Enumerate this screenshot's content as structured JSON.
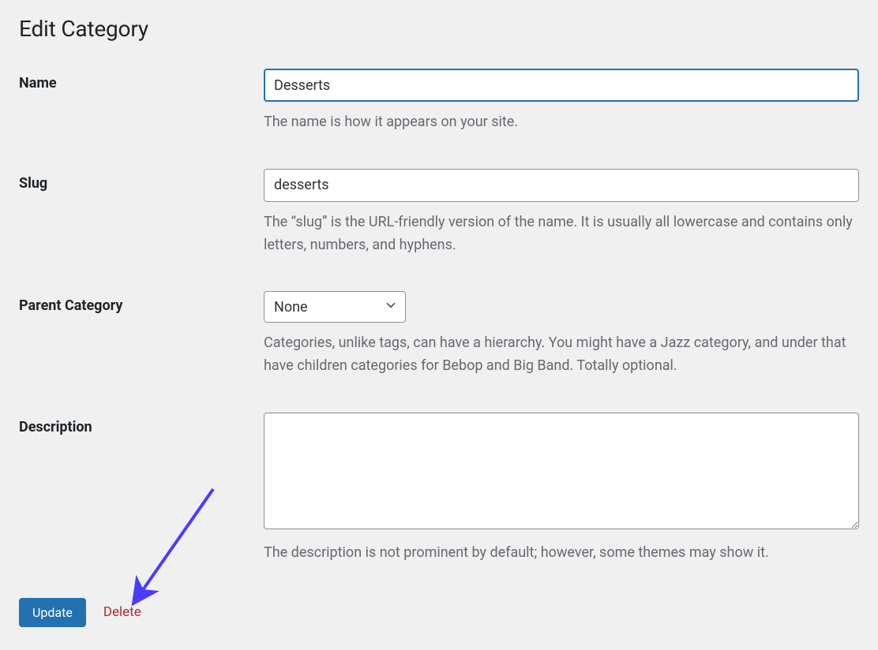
{
  "page": {
    "title": "Edit Category"
  },
  "fields": {
    "name": {
      "label": "Name",
      "value": "Desserts",
      "help": "The name is how it appears on your site."
    },
    "slug": {
      "label": "Slug",
      "value": "desserts",
      "help": "The “slug” is the URL-friendly version of the name. It is usually all lowercase and contains only letters, numbers, and hyphens."
    },
    "parent": {
      "label": "Parent Category",
      "selected": "None",
      "help": "Categories, unlike tags, can have a hierarchy. You might have a Jazz category, and under that have children categories for Bebop and Big Band. Totally optional."
    },
    "description": {
      "label": "Description",
      "value": "",
      "help": "The description is not prominent by default; however, some themes may show it."
    }
  },
  "actions": {
    "update": "Update",
    "delete": "Delete"
  },
  "annotations": {
    "arrow_color": "#4b3bff"
  }
}
